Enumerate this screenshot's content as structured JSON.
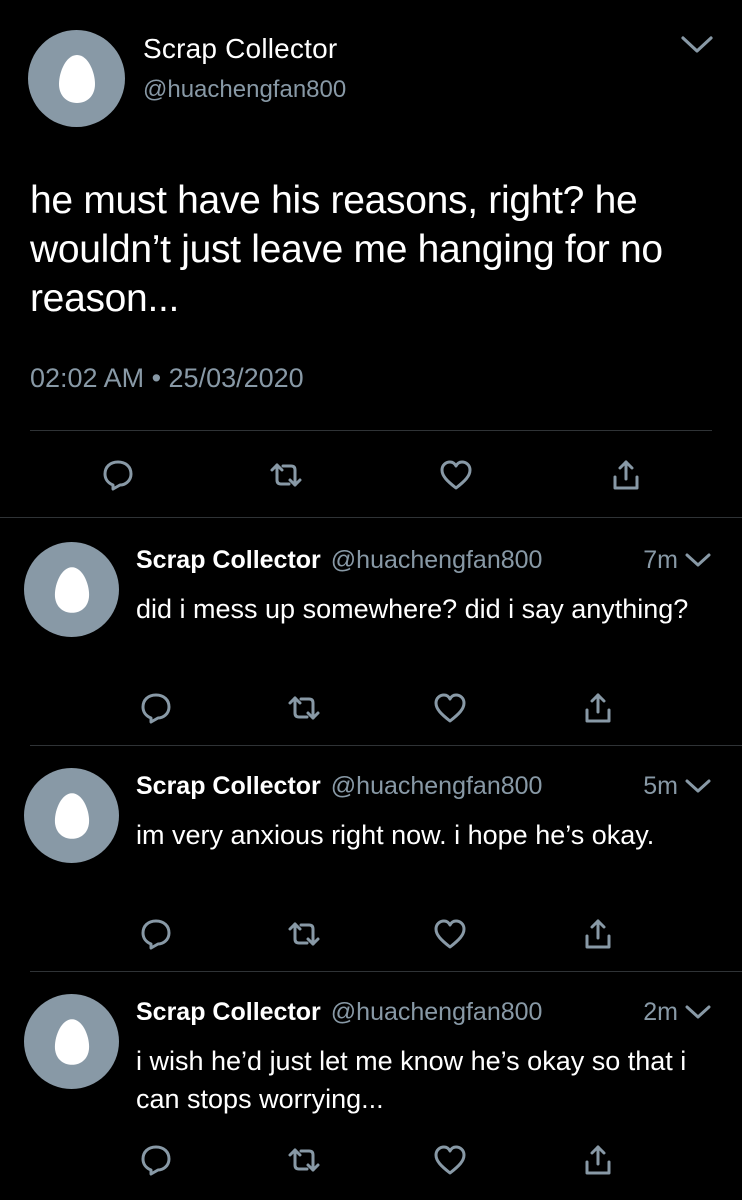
{
  "colors": {
    "background": "#000000",
    "text_primary": "#ffffff",
    "text_secondary": "#8899a6",
    "avatar_bg": "#8899a6",
    "divider": "#2f3336"
  },
  "main_tweet": {
    "display_name": "Scrap Collector",
    "handle": "@huachengfan800",
    "text": "he must have his reasons, right? he wouldn’t just leave me hanging for no reason...",
    "timestamp": "02:02 AM • 25/03/2020",
    "icons": [
      "reply-icon",
      "retweet-icon",
      "like-icon",
      "share-icon",
      "chevron-down-icon"
    ]
  },
  "replies": [
    {
      "display_name": "Scrap Collector",
      "handle": "@huachengfan800",
      "time": "7m",
      "text": "did i mess up somewhere? did i say anything?"
    },
    {
      "display_name": "Scrap Collector",
      "handle": "@huachengfan800",
      "time": "5m",
      "text": "im very anxious right now. i hope he’s okay."
    },
    {
      "display_name": "Scrap Collector",
      "handle": "@huachengfan800",
      "time": "2m",
      "text": "i wish he’d just let me know he’s okay so that i can stops worrying..."
    }
  ]
}
